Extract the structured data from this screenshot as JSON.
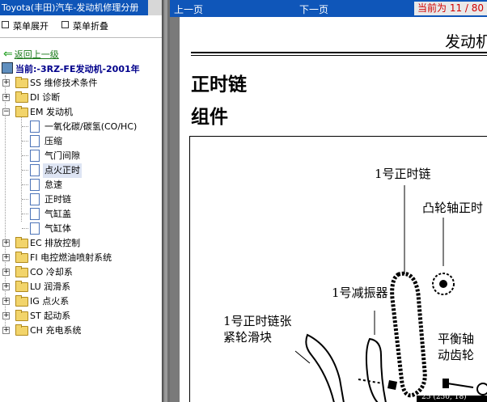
{
  "window": {
    "title": "Toyota(丰田)汽车-发动机修理分册"
  },
  "menu": {
    "expand": "菜单展开",
    "collapse": "菜单折叠"
  },
  "back_link": "返回上一级",
  "current": "当前:-3RZ-FE发动机-2001年",
  "tree": [
    {
      "code": "SS",
      "label": "维修技术条件"
    },
    {
      "code": "DI",
      "label": "诊断"
    },
    {
      "code": "EM",
      "label": "发动机",
      "children": [
        "一氧化碳/碳氢(CO/HC)",
        "压缩",
        "气门间隙",
        "点火正时",
        "怠速",
        "正时链",
        "气缸盖",
        "气缸体"
      ],
      "selected_child": 3
    },
    {
      "code": "EC",
      "label": "排放控制"
    },
    {
      "code": "FI",
      "label": "电控燃油喷射系统"
    },
    {
      "code": "CO",
      "label": "冷却系"
    },
    {
      "code": "LU",
      "label": "润滑系"
    },
    {
      "code": "IG",
      "label": "点火系"
    },
    {
      "code": "ST",
      "label": "起动系"
    },
    {
      "code": "CH",
      "label": "充电系统"
    }
  ],
  "viewer": {
    "prev": "上一页",
    "next": "下一页",
    "page_indicator": "当前为 11 / 80"
  },
  "document": {
    "header": "发动机",
    "title1": "正时链",
    "title2": "组件",
    "labels": {
      "chain1": "1号正时链",
      "cam_sprocket": "凸轮轴正时",
      "damper1": "1号减振器",
      "tensioner_slipper_1": "1号正时链张",
      "tensioner_slipper_2": "紧轮滑块",
      "balance_1": "平衡轴",
      "balance_2": "动齿轮",
      "torque": "25 (250, 18)"
    }
  },
  "colors": {
    "title_blue": "#0e55b8",
    "nav_blue": "#0f56b9",
    "page_red": "#d10000"
  }
}
